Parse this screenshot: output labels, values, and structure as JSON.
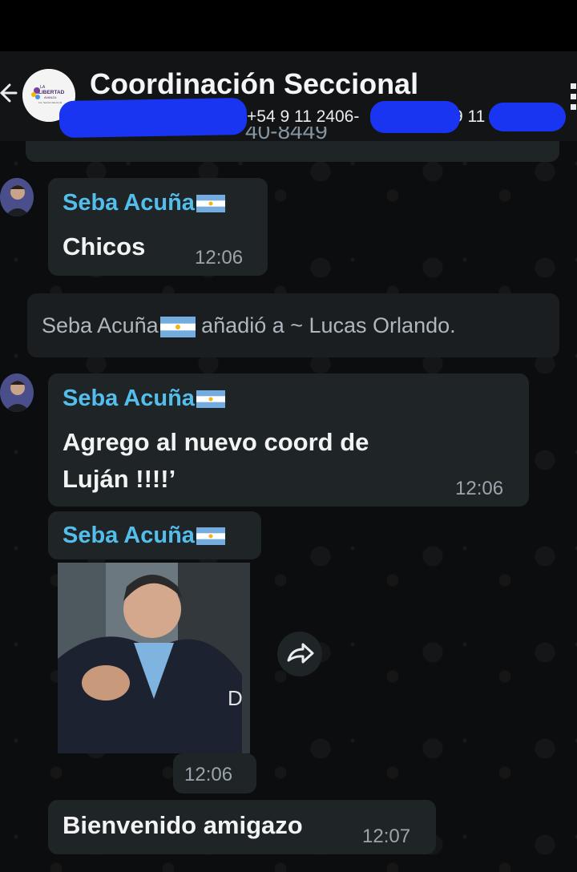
{
  "header": {
    "title": "Coordinación Seccional",
    "participants_prefix": "+54 9 11 2406-",
    "participants_suffix": "9 11",
    "cut_number": "40-8449"
  },
  "messages": [
    {
      "sender": "Seba Acuña",
      "text": "Chicos",
      "time": "12:06"
    },
    {
      "sender": "Seba Acuña",
      "text_line1": "Agrego al nuevo coord de",
      "text_line2": "Luján !!!!’",
      "time": "12:06"
    },
    {
      "sender": "Seba Acuña",
      "time": "12:06"
    },
    {
      "text": "Bienvenido amigazo",
      "time": "12:07"
    }
  ],
  "system": {
    "actor": "Seba Acuña",
    "rest": " añadió a ~ Lucas Orlando."
  },
  "group_avatar_text": {
    "line1": "LIBERTAD",
    "line2": "AVANZA",
    "line3": "1ra. Sección Electoral"
  },
  "icons": {
    "back": "arrow-left-icon",
    "menu": "more-vertical-icon",
    "forward": "forward-icon",
    "flag": "argentina-flag-icon"
  },
  "colors": {
    "sender_name": "#53bdeb",
    "bubble": "#1f2427",
    "redaction": "#1a35f2"
  }
}
